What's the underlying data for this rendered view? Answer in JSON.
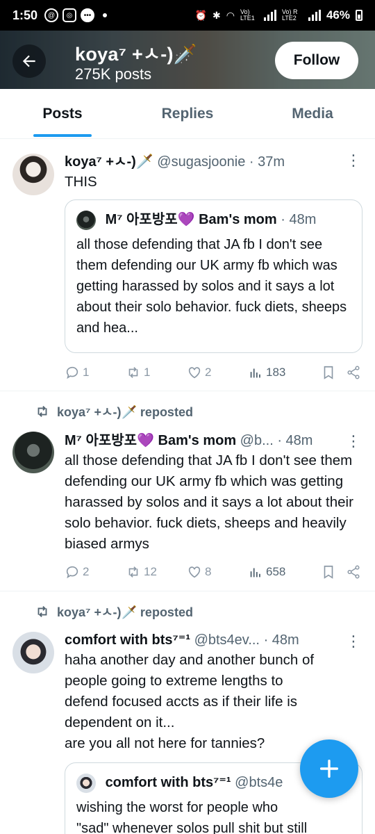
{
  "status_bar": {
    "time": "1:50",
    "battery": "46%",
    "net1": "Vo) LTE1",
    "net2": "Vo) R LTE2"
  },
  "header": {
    "title": "koya⁷ +ㅅ-)🗡️",
    "posts_count": "275K posts",
    "follow_label": "Follow"
  },
  "tabs": [
    {
      "label": "Posts",
      "active": true
    },
    {
      "label": "Replies",
      "active": false
    },
    {
      "label": "Media",
      "active": false
    }
  ],
  "posts": [
    {
      "name": "koya⁷ +ㅅ-)🗡️",
      "handle": "@sugasjoonie",
      "time": "· 37m",
      "text": "THIS",
      "quote": {
        "name": "M⁷ 아포방포💜 Bam's mom",
        "time": "· 48m",
        "text": "all those defending that JA fb I don't see them defending our UK army fb which was getting harassed by solos and it says a lot about their solo behavior. fuck diets, sheeps and hea..."
      },
      "replies": "1",
      "reposts": "1",
      "likes": "2",
      "views": "183"
    },
    {
      "repost_label": "koya⁷ +ㅅ-)🗡️ reposted",
      "name": "M⁷ 아포방포💜 Bam's mom",
      "handle": "@b...",
      "time": "· 48m",
      "text": "all those defending that JA fb I don't see them defending our UK army fb which was getting harassed by solos and it says a lot about their solo behavior. fuck diets, sheeps and heavily biased armys",
      "replies": "2",
      "reposts": "12",
      "likes": "8",
      "views": "658"
    },
    {
      "repost_label": "koya⁷ +ㅅ-)🗡️ reposted",
      "name": "comfort with bts⁷⁼¹",
      "handle": "@bts4ev...",
      "time": "· 48m",
      "text_lines": [
        "haha another day and another bunch of",
        "people going to extreme lengths to",
        "defend focused accts as if their life is",
        "dependent on it...",
        "are you all not here for tannies?"
      ],
      "quote": {
        "name": "comfort with bts⁷⁼¹",
        "handle": "@bts4e",
        "text_lines": [
          "wishing the worst for people who",
          "\"sad\" whenever solos pull shit but still"
        ]
      }
    }
  ]
}
